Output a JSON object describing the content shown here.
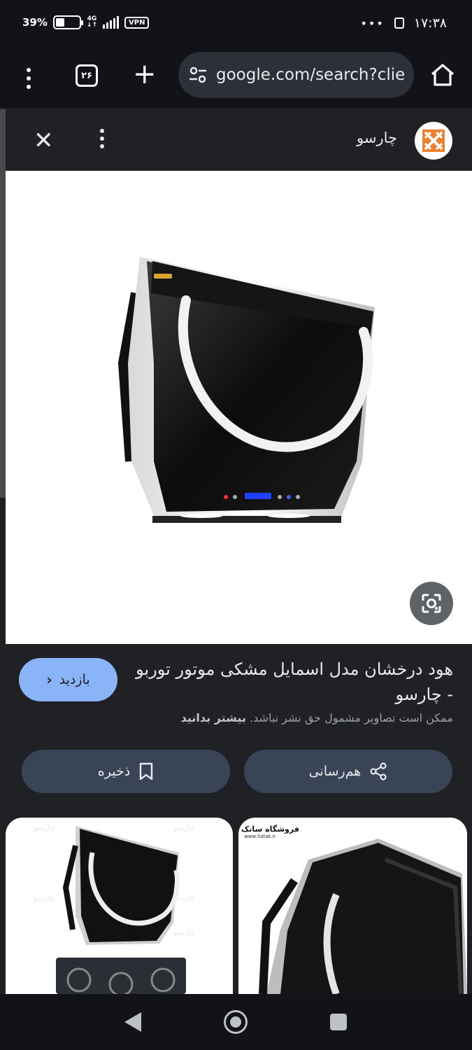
{
  "status_bar": {
    "battery": "39%",
    "battery_level": 0.39,
    "network_type": "4G",
    "data_rate": "↓↑",
    "vpn": "VPN",
    "more": "•••",
    "time": "۱۷:۳۸"
  },
  "browser": {
    "tab_count": "۲۶",
    "url": "google.com/search?clie",
    "icons": {
      "menu": "more-vert-icon",
      "new_tab": "plus-icon",
      "site_settings": "tune-icon",
      "home": "home-icon"
    }
  },
  "lens_header": {
    "site_name": "چارسو",
    "close": "✕"
  },
  "result": {
    "title": "هود درخشان مدل اسمایل مشکی موتور توربو - چارسو",
    "copyright_notice": "ممکن است تصاویر مشمول حق نشر نباشد.",
    "learn_more": "بیشتر بدانید",
    "visit_label": "بازدید",
    "save_label": "ذخیره",
    "share_label": "هم‌رسانی"
  },
  "thumbnails": [
    {
      "watermark": "چارسو"
    },
    {
      "watermark": "فروشگاه ساتک",
      "watermark_url": "www.Satak.ir"
    }
  ],
  "colors": {
    "visit_button": "#8ab4f8",
    "action_button": "#394457",
    "panel_bg": "#202124",
    "logo_orange": "#f07f2d"
  }
}
